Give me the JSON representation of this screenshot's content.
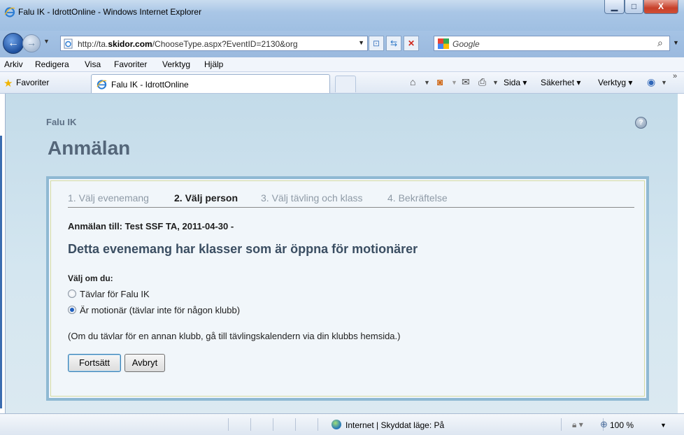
{
  "window": {
    "title": "Falu IK - IdrottOnline - Windows Internet Explorer",
    "min_glyph": "▁",
    "max_glyph": "□",
    "close_glyph": "X"
  },
  "address_bar": {
    "url_prefix": "http://ta.",
    "url_host": "skidor.com",
    "url_suffix": "/ChooseType.aspx?EventID=2130&org"
  },
  "search": {
    "placeholder": "Google"
  },
  "menu": {
    "items": [
      "Arkiv",
      "Redigera",
      "Visa",
      "Favoriter",
      "Verktyg",
      "Hjälp"
    ]
  },
  "favorites_bar": {
    "favorites_label": "Favoriter",
    "tab_title": "Falu IK - IdrottOnline",
    "commands": {
      "sida": "Sida ▾",
      "sakerhet": "Säkerhet ▾",
      "verktyg": "Verktyg ▾"
    }
  },
  "page": {
    "club_name": "Falu IK",
    "heading": "Anmälan",
    "help_glyph": "?",
    "steps": [
      {
        "label": "1. Välj evenemang",
        "active": false
      },
      {
        "label": "2. Välj person",
        "active": true
      },
      {
        "label": "3. Välj tävling och klass",
        "active": false
      },
      {
        "label": "4. Bekräftelse",
        "active": false
      }
    ],
    "registration_for": "Anmälan till:  Test SSF TA, 2011-04-30 -",
    "info_heading": "Detta evenemang har klasser som är öppna för motionärer",
    "choose_label": "Välj om du:",
    "options": [
      {
        "label": "Tävlar för Falu IK",
        "selected": false
      },
      {
        "label": "Är motionär (tävlar inte för någon klubb)",
        "selected": true
      }
    ],
    "note": "(Om du tävlar för en annan klubb, gå till tävlingskalendern via din klubbs hemsida.)",
    "continue_button": "Fortsätt",
    "cancel_button": "Avbryt"
  },
  "status_bar": {
    "zone_text": "Internet | Skyddat läge: På",
    "zoom": "100 %"
  }
}
